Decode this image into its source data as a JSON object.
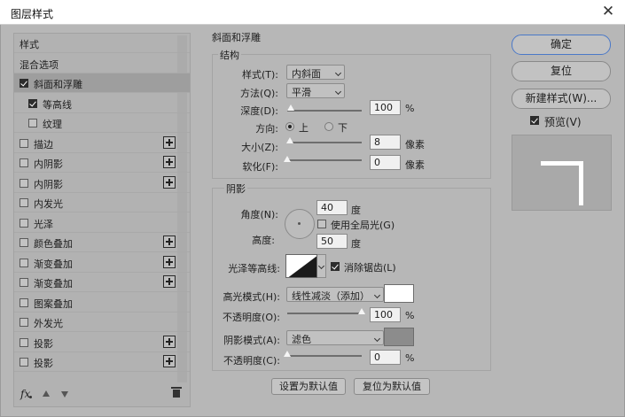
{
  "window": {
    "title": "图层样式",
    "close_glyph": "✕"
  },
  "styles_list": {
    "items": [
      {
        "label": "样式",
        "checkbox": false,
        "checked": false,
        "plus": false,
        "selected": false,
        "indent": 0
      },
      {
        "label": "混合选项",
        "checkbox": false,
        "checked": false,
        "plus": false,
        "selected": false,
        "indent": 0
      },
      {
        "label": "斜面和浮雕",
        "checkbox": true,
        "checked": true,
        "plus": false,
        "selected": true,
        "indent": 0
      },
      {
        "label": "等高线",
        "checkbox": true,
        "checked": true,
        "plus": false,
        "selected": false,
        "indent": 1
      },
      {
        "label": "纹理",
        "checkbox": true,
        "checked": false,
        "plus": false,
        "selected": false,
        "indent": 1
      },
      {
        "label": "描边",
        "checkbox": true,
        "checked": false,
        "plus": true,
        "selected": false,
        "indent": 0
      },
      {
        "label": "内阴影",
        "checkbox": true,
        "checked": false,
        "plus": true,
        "selected": false,
        "indent": 0
      },
      {
        "label": "内阴影",
        "checkbox": true,
        "checked": false,
        "plus": true,
        "selected": false,
        "indent": 0
      },
      {
        "label": "内发光",
        "checkbox": true,
        "checked": false,
        "plus": false,
        "selected": false,
        "indent": 0
      },
      {
        "label": "光泽",
        "checkbox": true,
        "checked": false,
        "plus": false,
        "selected": false,
        "indent": 0
      },
      {
        "label": "颜色叠加",
        "checkbox": true,
        "checked": false,
        "plus": true,
        "selected": false,
        "indent": 0
      },
      {
        "label": "渐变叠加",
        "checkbox": true,
        "checked": false,
        "plus": true,
        "selected": false,
        "indent": 0
      },
      {
        "label": "渐变叠加",
        "checkbox": true,
        "checked": false,
        "plus": true,
        "selected": false,
        "indent": 0
      },
      {
        "label": "图案叠加",
        "checkbox": true,
        "checked": false,
        "plus": false,
        "selected": false,
        "indent": 0
      },
      {
        "label": "外发光",
        "checkbox": true,
        "checked": false,
        "plus": false,
        "selected": false,
        "indent": 0
      },
      {
        "label": "投影",
        "checkbox": true,
        "checked": false,
        "plus": true,
        "selected": false,
        "indent": 0
      },
      {
        "label": "投影",
        "checkbox": true,
        "checked": false,
        "plus": true,
        "selected": false,
        "indent": 0
      }
    ],
    "footer": {
      "fx_label": "fx",
      "up_icon": "arrow-up-icon",
      "down_icon": "arrow-down-icon",
      "delete_icon": "trash-icon"
    }
  },
  "bevel": {
    "section_title": "斜面和浮雕",
    "structure": {
      "title": "结构",
      "style_label": "样式(T):",
      "style_value": "内斜面",
      "technique_label": "方法(Q):",
      "technique_value": "平滑",
      "depth_label": "深度(D):",
      "depth_value": "100",
      "depth_unit": "%",
      "depth_level": 0.05,
      "direction_label": "方向:",
      "direction_up": "上",
      "direction_down": "下",
      "direction_selected": "上",
      "size_label": "大小(Z):",
      "size_value": "8",
      "size_unit": "像素",
      "size_level": 0.03,
      "soften_label": "软化(F):",
      "soften_value": "0",
      "soften_unit": "像素",
      "soften_level": 0
    },
    "shading": {
      "title": "阴影",
      "angle_label": "角度(N):",
      "angle_value": "40",
      "angle_unit": "度",
      "global_light_label": "使用全局光(G)",
      "global_light_checked": false,
      "altitude_label": "高度:",
      "altitude_value": "50",
      "altitude_unit": "度",
      "gloss_contour_label": "光泽等高线:",
      "anti_alias_label": "消除锯齿(L)",
      "anti_alias_checked": true,
      "highlight_mode_label": "高光模式(H):",
      "highlight_mode_value": "线性减淡（添加）",
      "highlight_color": "#ffffff",
      "highlight_opacity_label": "不透明度(O):",
      "highlight_opacity_value": "100",
      "highlight_opacity_unit": "%",
      "highlight_opacity_level": 1.0,
      "shadow_mode_label": "阴影模式(A):",
      "shadow_mode_value": "滤色",
      "shadow_color": "#8c8c8c",
      "shadow_opacity_label": "不透明度(C):",
      "shadow_opacity_value": "0",
      "shadow_opacity_unit": "%",
      "shadow_opacity_level": 0
    },
    "make_default_label": "设置为默认值",
    "reset_default_label": "复位为默认值"
  },
  "actions": {
    "ok_label": "确定",
    "reset_label": "复位",
    "new_style_label": "新建样式(W)...",
    "preview_label": "预览(V)",
    "preview_checked": true
  },
  "colors": {
    "accent": "#4a78c8",
    "panel": "#b7b7b7"
  }
}
